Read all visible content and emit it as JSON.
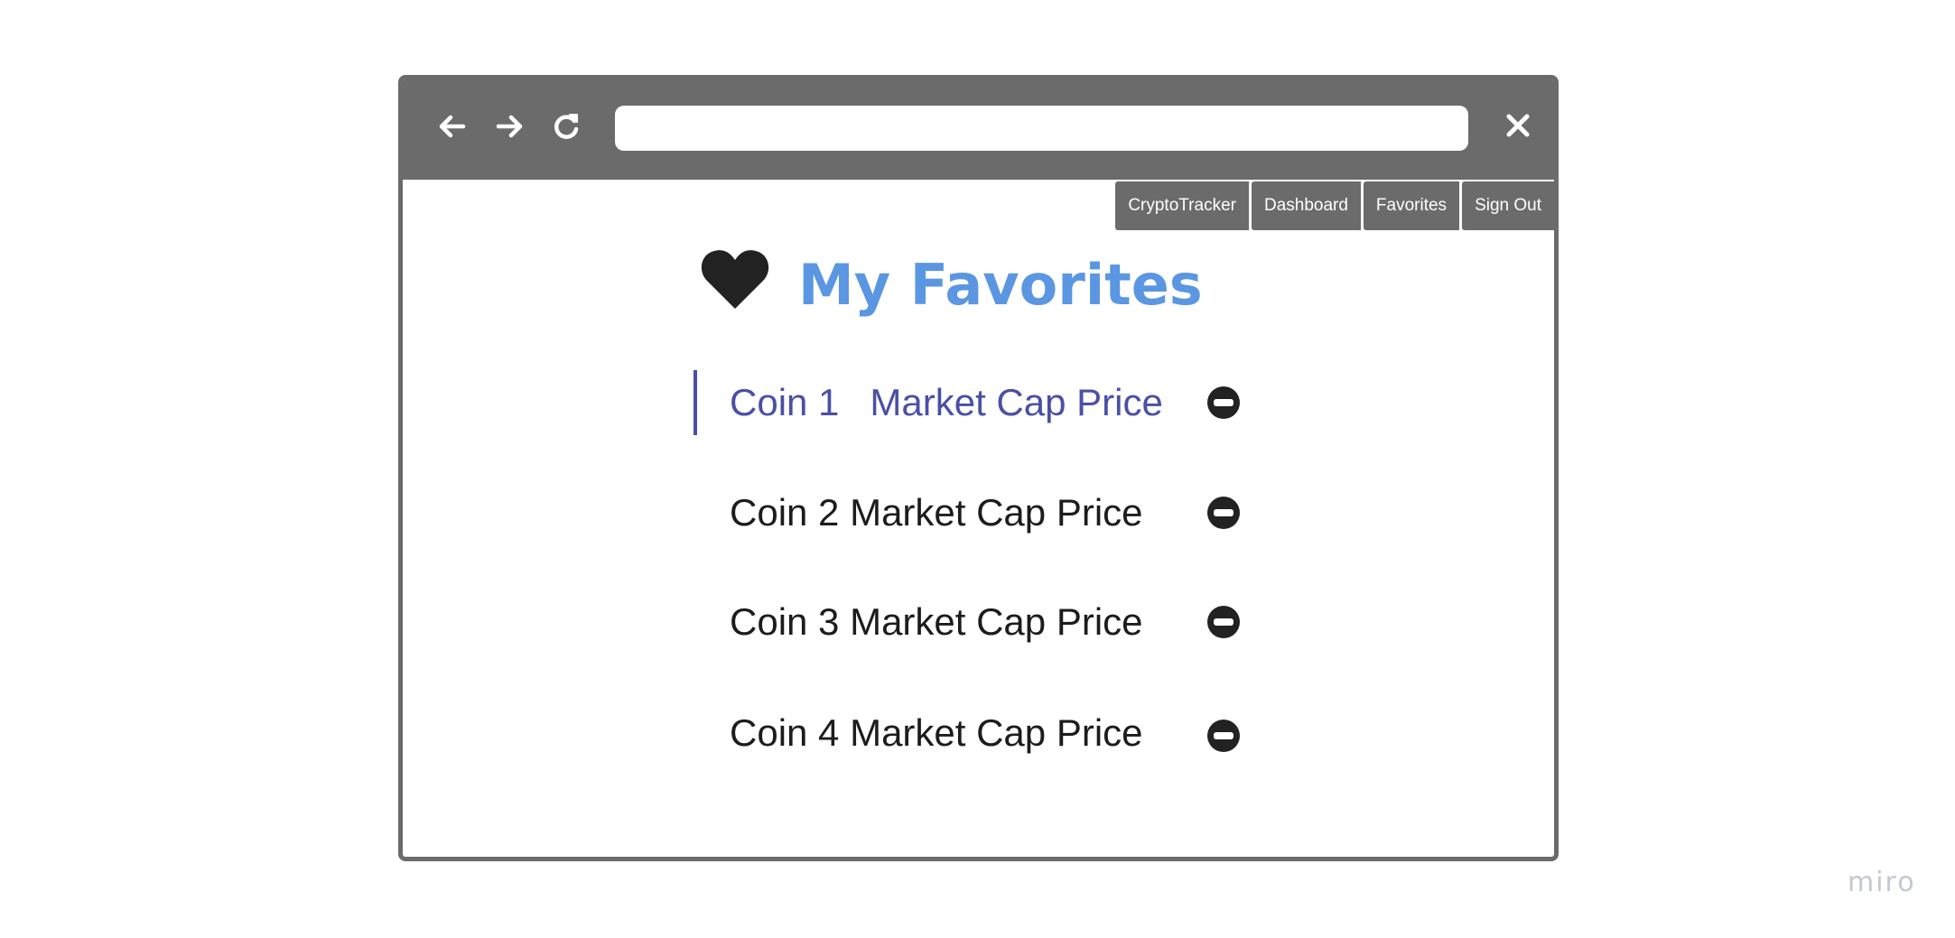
{
  "browser": {
    "address_value": "",
    "address_placeholder": "",
    "icons": [
      "back-arrow-icon",
      "forward-arrow-icon",
      "reload-icon",
      "close-icon"
    ]
  },
  "nav": {
    "items": [
      {
        "label": "CryptoTracker"
      },
      {
        "label": "Dashboard"
      },
      {
        "label": "Favorites"
      },
      {
        "label": "Sign Out"
      }
    ]
  },
  "page": {
    "title": "My Favorites",
    "title_icon": "heart-icon",
    "title_color": "#5b96e2"
  },
  "favorites": [
    {
      "coin": "Coin 1",
      "details": "Market Cap Price",
      "active": true,
      "remove_icon": "minus-circle-icon"
    },
    {
      "coin": "Coin 2",
      "details": "Market Cap Price",
      "active": false,
      "remove_icon": "minus-circle-icon"
    },
    {
      "coin": "Coin 3",
      "details": "Market Cap Price",
      "active": false,
      "remove_icon": "minus-circle-icon"
    },
    {
      "coin": "Coin 4",
      "details": "Market Cap Price",
      "active": false,
      "remove_icon": "minus-circle-icon"
    }
  ],
  "colors": {
    "chrome": "#6b6b6b",
    "active_row": "#4a4fa6",
    "text": "#1c1c1c"
  },
  "watermark": "miro"
}
